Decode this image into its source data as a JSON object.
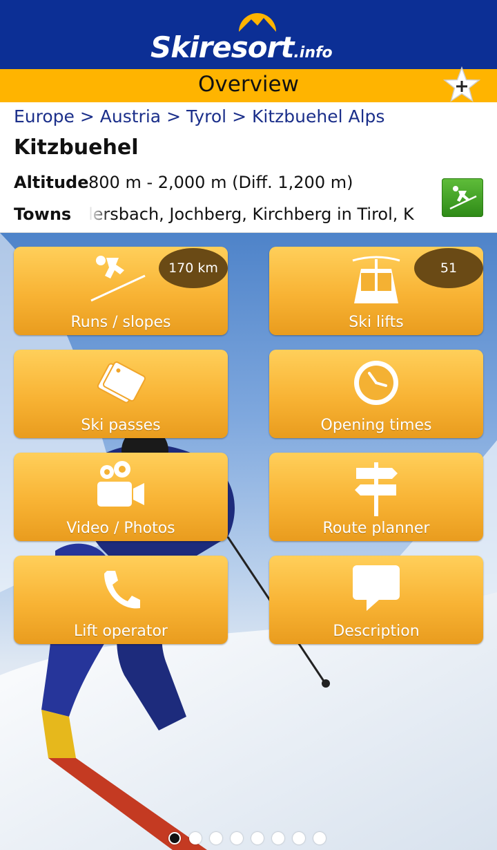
{
  "brand": {
    "logo_text": "Skiresort",
    "logo_tld": ".info",
    "colors": {
      "header": "#0c2f95",
      "titlebar": "#ffb400",
      "tile": "#f8b334",
      "badge": "#6a4a15"
    }
  },
  "titlebar": {
    "title": "Overview",
    "favorite_icon": "star-plus-icon"
  },
  "breadcrumb": {
    "items": [
      "Europe",
      "Austria",
      "Tyrol",
      "Kitzbuehel Alps"
    ],
    "separator": ">"
  },
  "resort": {
    "name": "Kitzbuehel",
    "altitude_label": "Altitude",
    "altitude_value": "800 m - 2,000 m (Diff. 1,200 m)",
    "towns_label": "Towns",
    "towns_value": "lersbach, Jochberg, Kirchberg in Tirol, K",
    "badge_icon": "skier-icon"
  },
  "tiles": [
    {
      "label": "Runs / slopes",
      "icon": "downhill-skier-icon",
      "badge": "170 km"
    },
    {
      "label": "Ski lifts",
      "icon": "gondola-icon",
      "badge": "51"
    },
    {
      "label": "Ski passes",
      "icon": "ticket-icon"
    },
    {
      "label": "Opening times",
      "icon": "clock-icon"
    },
    {
      "label": "Video / Photos",
      "icon": "video-camera-icon"
    },
    {
      "label": "Route planner",
      "icon": "signpost-icon"
    },
    {
      "label": "Lift operator",
      "icon": "phone-icon"
    },
    {
      "label": "Description",
      "icon": "speech-bubble-icon"
    }
  ],
  "pager": {
    "total": 8,
    "active": 1
  }
}
